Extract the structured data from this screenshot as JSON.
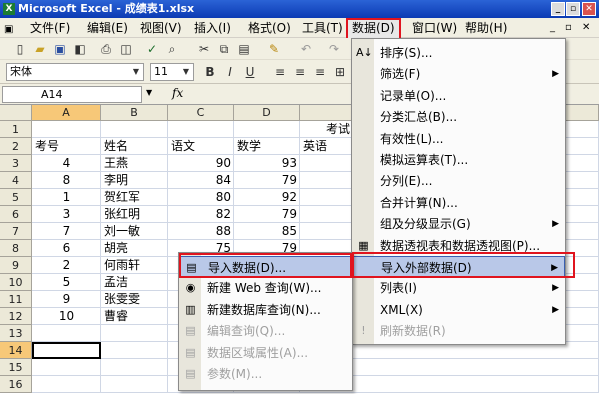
{
  "title": "Microsoft Excel - 成绩表1.xlsx",
  "window_buttons": {
    "min": "_",
    "restore": "▫",
    "close": "✕"
  },
  "menubar": {
    "file": "文件(F)",
    "edit": "编辑(E)",
    "view": "视图(V)",
    "insert": "插入(I)",
    "format": "格式(O)",
    "tools": "工具(T)",
    "data": "数据(D)",
    "window": "窗口(W)",
    "help": "帮助(H)"
  },
  "toolbar": {
    "font": "宋体",
    "size": "11"
  },
  "formula_bar": {
    "name_box": "A14",
    "fx": "fx"
  },
  "columns": [
    "A",
    "B",
    "C",
    "D",
    "E"
  ],
  "rows": [
    "1",
    "2",
    "3",
    "4",
    "5",
    "6",
    "7",
    "8",
    "9",
    "10",
    "11",
    "12",
    "13",
    "14",
    "15",
    "16"
  ],
  "sheet": {
    "e1": "考试",
    "headers": [
      "考号",
      "姓名",
      "语文",
      "数学",
      "英语"
    ],
    "data": [
      [
        "4",
        "王燕",
        "90",
        "93"
      ],
      [
        "8",
        "李明",
        "84",
        "79"
      ],
      [
        "1",
        "贺红军",
        "80",
        "92"
      ],
      [
        "3",
        "张红明",
        "82",
        "79"
      ],
      [
        "7",
        "刘一敏",
        "88",
        "85"
      ],
      [
        "6",
        "胡亮",
        "75",
        "79"
      ],
      [
        "2",
        "何雨轩",
        "",
        ""
      ],
      [
        "5",
        "孟洁",
        "",
        ""
      ],
      [
        "9",
        "张雯雯",
        "",
        ""
      ],
      [
        "10",
        "曹睿",
        "",
        ""
      ]
    ]
  },
  "data_menu": [
    {
      "label": "排序(S)...",
      "icon": "sort-icon",
      "glyph": "A↓"
    },
    {
      "label": "筛选(F)",
      "arrow": true
    },
    {
      "label": "记录单(O)..."
    },
    {
      "label": "分类汇总(B)..."
    },
    {
      "label": "有效性(L)..."
    },
    {
      "label": "模拟运算表(T)..."
    },
    {
      "label": "分列(E)..."
    },
    {
      "label": "合并计算(N)..."
    },
    {
      "label": "组及分级显示(G)",
      "arrow": true
    },
    {
      "label": "数据透视表和数据透视图(P)...",
      "icon": "pivot-table-icon",
      "glyph": "▦"
    },
    {
      "label": "导入外部数据(D)",
      "arrow": true,
      "highlight": true
    },
    {
      "label": "列表(I)",
      "arrow": true
    },
    {
      "label": "XML(X)",
      "arrow": true
    },
    {
      "label": "刷新数据(R)",
      "disabled": true,
      "icon": "refresh-icon",
      "glyph": "!"
    }
  ],
  "import_menu": [
    {
      "label": "导入数据(D)...",
      "icon": "import-data-icon",
      "glyph": "▤",
      "highlight": true
    },
    {
      "label": "新建 Web 查询(W)...",
      "icon": "web-query-icon",
      "glyph": "◉"
    },
    {
      "label": "新建数据库查询(N)...",
      "icon": "database-query-icon",
      "glyph": "▥"
    },
    {
      "label": "编辑查询(Q)...",
      "disabled": true,
      "icon": "edit-query-icon",
      "glyph": "▤"
    },
    {
      "label": "数据区域属性(A)...",
      "disabled": true,
      "icon": "range-properties-icon",
      "glyph": "▤"
    },
    {
      "label": "参数(M)...",
      "disabled": true,
      "icon": "parameters-icon",
      "glyph": "▤"
    }
  ]
}
